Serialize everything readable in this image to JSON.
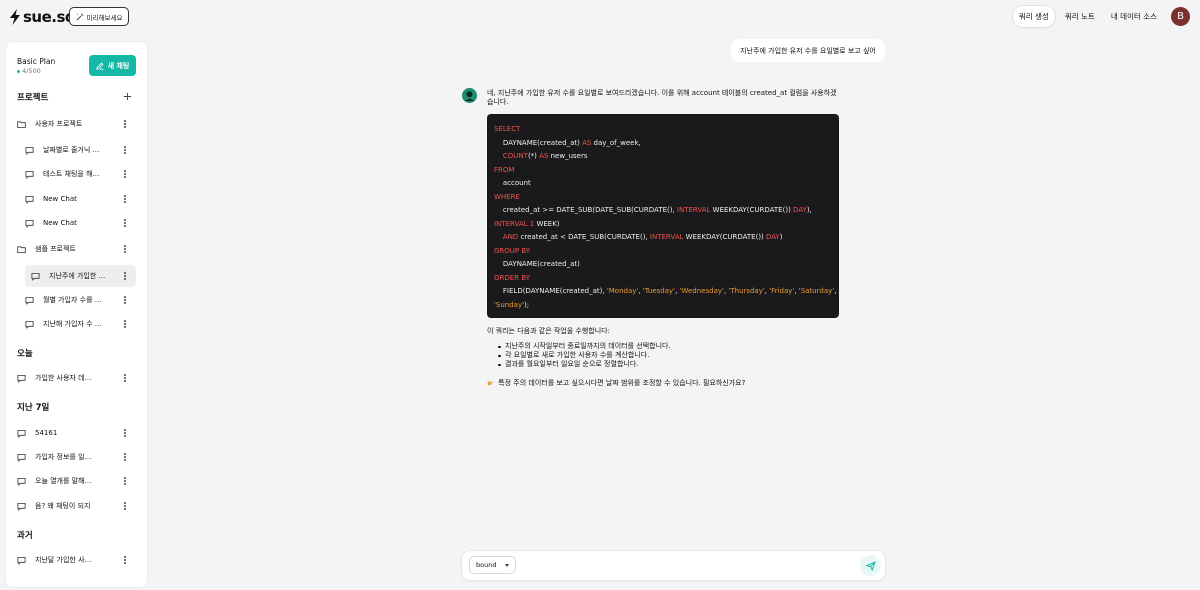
{
  "header": {
    "logo_text": "sue.sql",
    "try_button": "미리해보세요",
    "nav": [
      "쿼리 생성",
      "쿼리 노트",
      "내 데이터 소스"
    ],
    "avatar_letter": "B"
  },
  "sidebar": {
    "plan_name": "Basic Plan",
    "plan_usage": "4/500",
    "new_chat_label": "새 채팅",
    "sections": {
      "projects": "프로젝트",
      "today": "오늘",
      "last7": "지난 7일",
      "past": "과거"
    },
    "project_user": "사용자 프로젝트",
    "project_user_chats": [
      "날짜별로 줄거닉 ...",
      "테스트 채팅을 해...",
      "New Chat",
      "New Chat"
    ],
    "project_sample": "샘플 프로젝트",
    "project_sample_chats": [
      "지난주에 가입한 ...",
      "월별 가입자 수를 ...",
      "지난해 가입자 수 ..."
    ],
    "today_chats": [
      "가입한 사용자 데이..."
    ],
    "last7_chats": [
      "54161",
      "가입자 정보를 일자...",
      "오늘 열개를 말해보자",
      "음? 왜 채팅이 되지"
    ],
    "past_chats": [
      "지난달 가입한 사람 수"
    ]
  },
  "chat": {
    "user_message": "지난주에 가입한 유저 수를 요일별로 보고 싶어",
    "bot_intro": "네, 지난주에 가입한 유저 수를 요일별로 보여드리겠습니다. 이를 위해 account 테이블의 created_at 컬럼을 사용하겠습니다.",
    "code_lines": [
      [
        [
          "kw",
          "SELECT"
        ]
      ],
      [
        [
          "tx",
          "    DAYNAME(created_at) "
        ],
        [
          "kw",
          "AS"
        ],
        [
          "tx",
          " day_of_week,"
        ]
      ],
      [
        [
          "tx",
          "    "
        ],
        [
          "kw",
          "COUNT"
        ],
        [
          "tx",
          "(*) "
        ],
        [
          "kw",
          "AS"
        ],
        [
          "tx",
          " new_users"
        ]
      ],
      [
        [
          "kw",
          "FROM"
        ]
      ],
      [
        [
          "tx",
          "    account"
        ]
      ],
      [
        [
          "kw",
          "WHERE"
        ]
      ],
      [
        [
          "tx",
          "    created_at >= DATE_SUB(DATE_SUB(CURDATE(), "
        ],
        [
          "kw",
          "INTERVAL"
        ],
        [
          "tx",
          " WEEKDAY(CURDATE()) "
        ],
        [
          "kw",
          "DAY"
        ],
        [
          "tx",
          "),"
        ]
      ],
      [
        [
          "kw",
          "INTERVAL"
        ],
        [
          "tx",
          " "
        ],
        [
          "num",
          "1"
        ],
        [
          "tx",
          " WEEK)"
        ]
      ],
      [
        [
          "tx",
          "    "
        ],
        [
          "kw",
          "AND"
        ],
        [
          "tx",
          " created_at < DATE_SUB(CURDATE(), "
        ],
        [
          "kw",
          "INTERVAL"
        ],
        [
          "tx",
          " WEEKDAY(CURDATE()) "
        ],
        [
          "kw",
          "DAY"
        ],
        [
          "tx",
          ")"
        ]
      ],
      [
        [
          "kw",
          "GROUP BY"
        ]
      ],
      [
        [
          "tx",
          "    DAYNAME(created_at)"
        ]
      ],
      [
        [
          "kw",
          "ORDER BY"
        ]
      ],
      [
        [
          "tx",
          "    FIELD(DAYNAME(created_at), "
        ],
        [
          "st",
          "'Monday'"
        ],
        [
          "tx",
          ", "
        ],
        [
          "st",
          "'Tuesday'"
        ],
        [
          "tx",
          ", "
        ],
        [
          "st",
          "'Wednesday'"
        ],
        [
          "tx",
          ", "
        ],
        [
          "st",
          "'Thursday'"
        ],
        [
          "tx",
          ", "
        ],
        [
          "st",
          "'Friday'"
        ],
        [
          "tx",
          ", "
        ],
        [
          "st",
          "'Saturday'"
        ],
        [
          "tx",
          ","
        ]
      ],
      [
        [
          "st",
          "'Sunday'"
        ],
        [
          "tx",
          ");"
        ]
      ]
    ],
    "after_code": "이 쿼리는 다음과 같은 작업을 수행합니다:",
    "bullets": [
      "지난주의 시작일부터 종료일까지의 데이터를 선택합니다.",
      "각 요일별로 새로 가입한 사용자 수를 계산합니다.",
      "결과를 월요일부터 일요일 순으로 정렬합니다."
    ],
    "tip": "특정 주의 데이터를 보고 싶으시다면 날짜 범위를 조정할 수 있습니다. 필요하신가요?"
  },
  "input": {
    "db_select_value": "bound"
  },
  "colors": {
    "accent": "#14b8a6",
    "code_bg": "#1a1a1c",
    "keyword": "#ef5350",
    "string": "#e89a37"
  },
  "icons": {
    "logo": "lightning-icon",
    "try": "wand-icon",
    "new_chat": "pencil-icon",
    "add_project": "plus-icon",
    "folder": "folder-icon",
    "chat": "chat-bubble-icon",
    "more": "more-vertical-icon",
    "send": "send-icon",
    "tip": "pointing-hand-icon"
  }
}
